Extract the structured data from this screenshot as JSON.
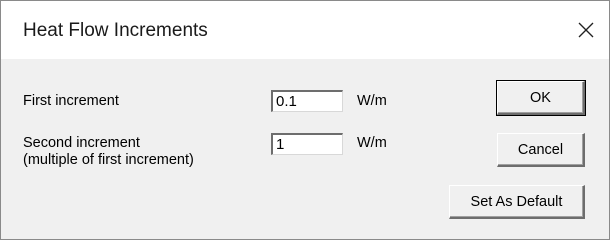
{
  "window": {
    "title": "Heat Flow Increments"
  },
  "fields": {
    "first": {
      "label": "First increment",
      "value": "0.1",
      "unit": "W/m"
    },
    "second": {
      "label_line1": "Second increment",
      "label_line2": "(multiple of first increment)",
      "value": "1",
      "unit": "W/m"
    }
  },
  "buttons": {
    "ok": "OK",
    "cancel": "Cancel",
    "set_default": "Set As Default"
  },
  "icons": {
    "close": "close-icon"
  }
}
